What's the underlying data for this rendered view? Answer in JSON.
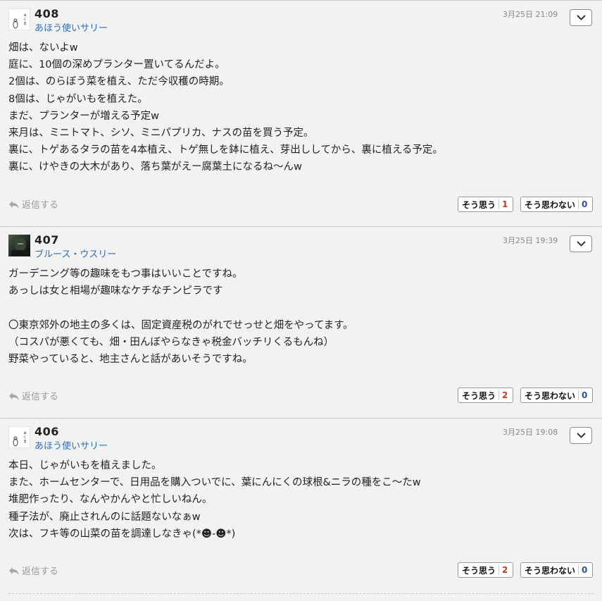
{
  "comments": [
    {
      "number": "408",
      "author": "あほう使いサリー",
      "date": "3月25日 21:09",
      "avatar": "sally-avatar",
      "lines": [
        "畑は、ないよw",
        "庭に、10個の深めプランター置いてるんだよ。",
        "2個は、のらぼう菜を植え、ただ今収穫の時期。",
        "8個は、じゃがいもを植えた。",
        "まだ、プランターが増える予定w",
        "来月は、ミニトマト、シソ、ミニパプリカ、ナスの苗を買う予定。",
        "裏に、トゲあるタラの苗を4本植え、トゲ無しを鉢に植え、芽出ししてから、裏に植える予定。",
        "裏に、けやきの大木があり、落ち葉がえー腐葉土になるね〜んw"
      ],
      "reply_label": "返信する",
      "agree_label": "そう思う",
      "agree_count": "1",
      "disagree_label": "そう思わない",
      "disagree_count": "0"
    },
    {
      "number": "407",
      "author": "ブルース・ウスリー",
      "date": "3月25日 19:39",
      "avatar": "bruce-avatar",
      "lines": [
        "ガーデニング等の趣味をもつ事はいいことですね。",
        "あっしは女と相場が趣味なケチなチンピラです",
        "",
        "〇東京郊外の地主の多くは、固定資産税のがれでせっせと畑をやってます。",
        "（コスパが悪くても、畑・田んぼやらなきゃ税金バッチリくるもんね）",
        "野菜やっていると、地主さんと話があいそうですね。"
      ],
      "reply_label": "返信する",
      "agree_label": "そう思う",
      "agree_count": "2",
      "disagree_label": "そう思わない",
      "disagree_count": "0"
    },
    {
      "number": "406",
      "author": "あほう使いサリー",
      "date": "3月25日 19:08",
      "avatar": "sally-avatar",
      "lines": [
        "本日、じゃがいもを植えました。",
        "また、ホームセンターで、日用品を購入ついでに、葉にんにくの球根&ニラの種をこ〜たw",
        "堆肥作ったり、なんやかんやと忙しいねん。",
        "種子法が、廃止されんのに話題ないなぁw",
        "次は、フキ等の山菜の苗を調達しなきゃ(*☻-☻*)"
      ],
      "reply_label": "返信する",
      "agree_label": "そう思う",
      "agree_count": "2",
      "disagree_label": "そう思わない",
      "disagree_count": "0"
    }
  ],
  "icons": {
    "menu": "chevron-down-icon",
    "reply": "reply-arrow-icon"
  },
  "colors": {
    "author_link": "#2b6cb8",
    "agree_count": "#c0392b",
    "disagree_count": "#2b4fa8"
  }
}
